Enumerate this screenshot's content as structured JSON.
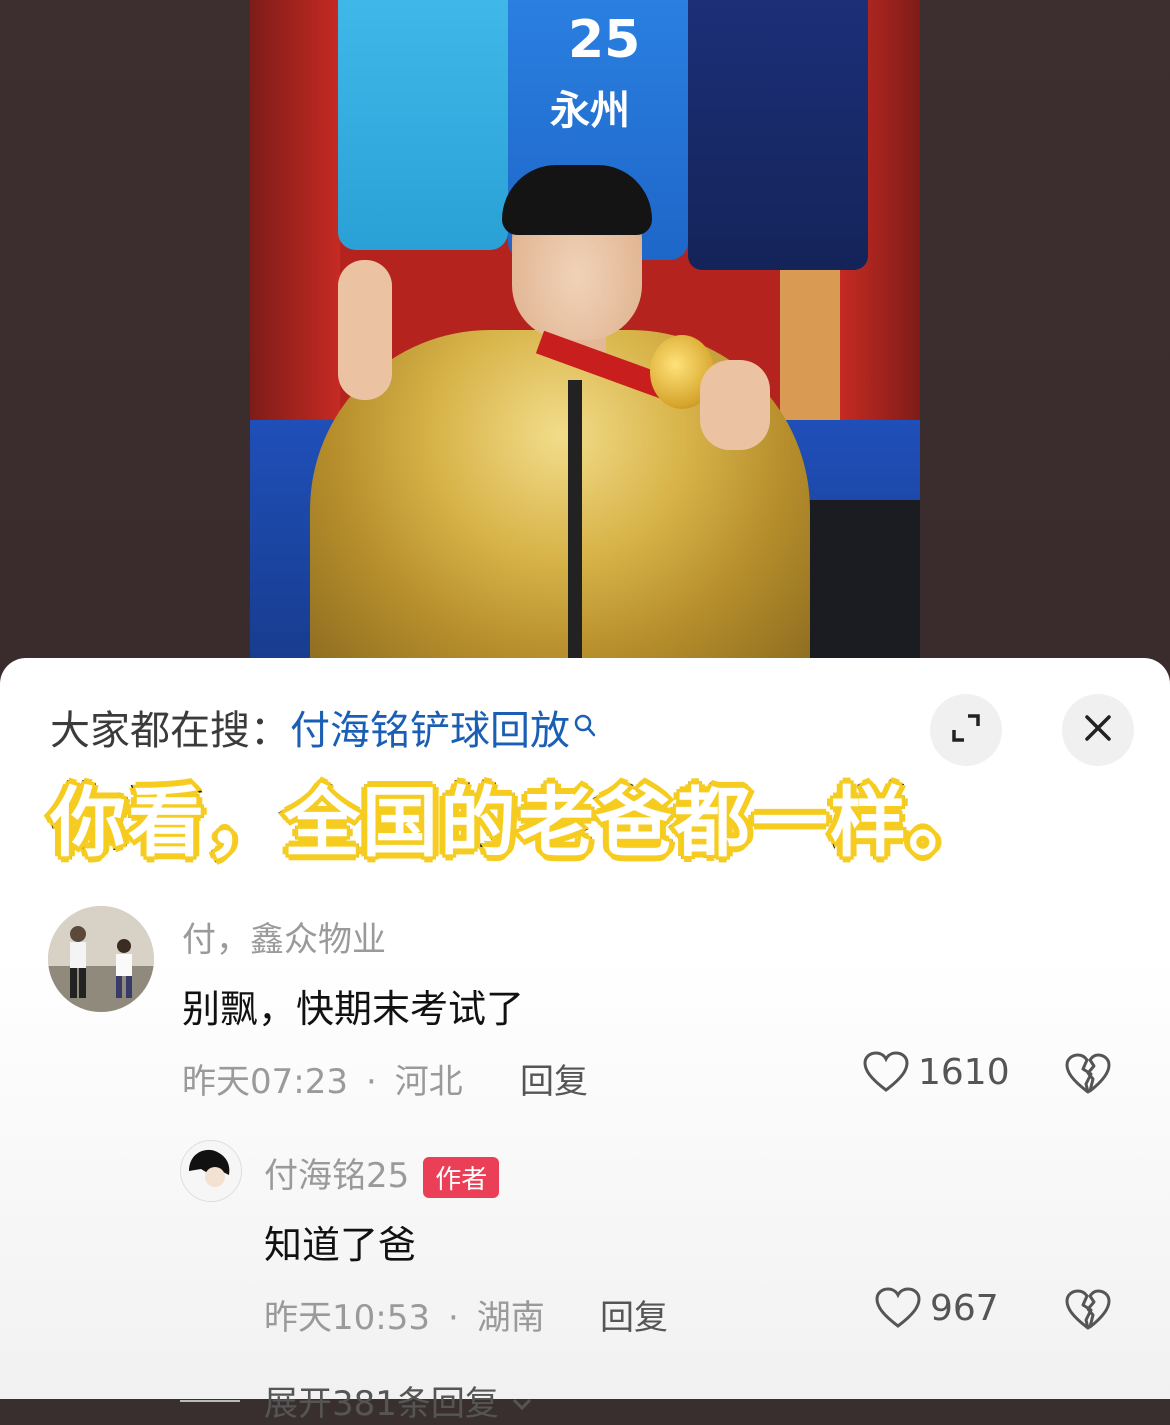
{
  "search": {
    "prefix": "大家都在搜：",
    "query": "付海铭铲球回放"
  },
  "caption": "你看，全国的老爸都一样。",
  "photo": {
    "jersey_number": "25",
    "jersey_city": "永州"
  },
  "comments": [
    {
      "user": "付，鑫众物业",
      "text": "别飘，快期末考试了",
      "time": "昨天07:23",
      "location": "河北",
      "reply_label": "回复",
      "likes": "1610"
    }
  ],
  "replies": [
    {
      "user": "付海铭25",
      "badge": "作者",
      "text": "知道了爸",
      "time": "昨天10:53",
      "location": "湖南",
      "reply_label": "回复",
      "likes": "967"
    }
  ],
  "expand_label": "展开381条回复",
  "colors": {
    "link": "#1a5fb4",
    "badge": "#ea3f56",
    "caption_outline": "#f5cc1f"
  }
}
